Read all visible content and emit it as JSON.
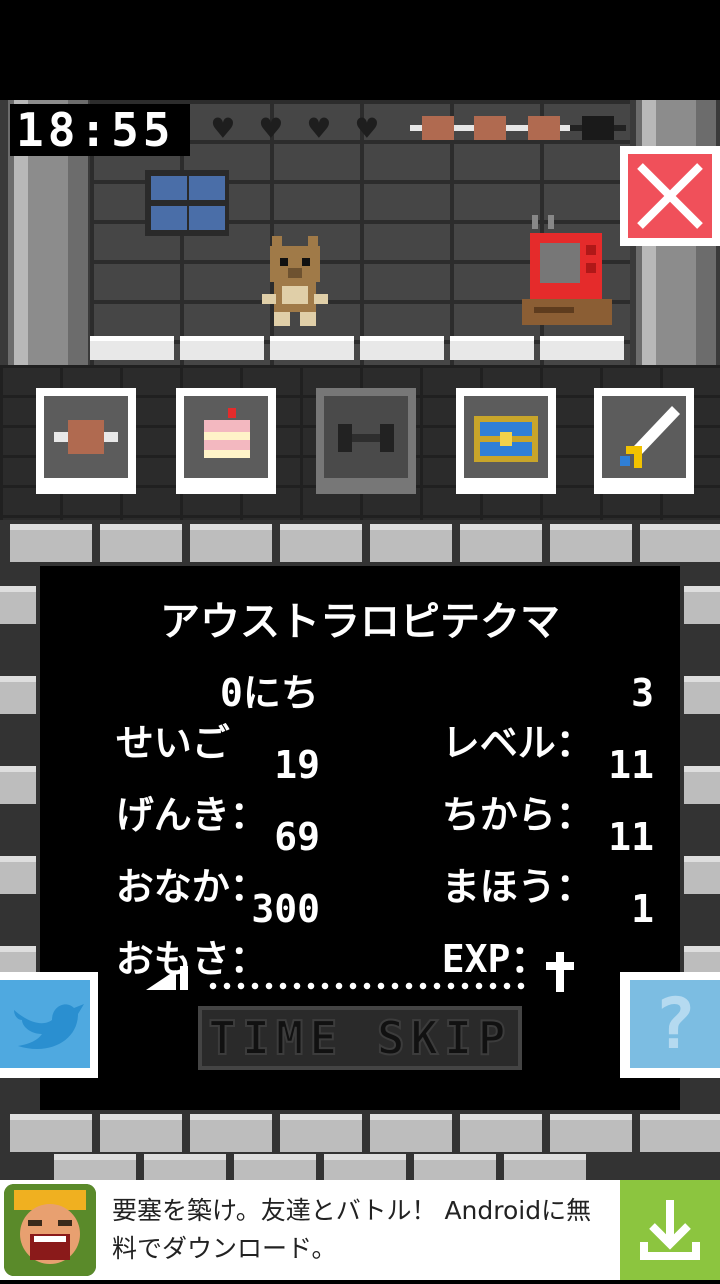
{
  "hud": {
    "clock": "18:55",
    "hearts_filled": 0,
    "hearts_total": 4,
    "food_filled": 3,
    "food_total": 4
  },
  "close_icon": "close-x-icon",
  "items": [
    {
      "name": "meat",
      "icon": "meat-icon",
      "enabled": true
    },
    {
      "name": "cake",
      "icon": "cake-icon",
      "enabled": true
    },
    {
      "name": "dumbbell",
      "icon": "dumbbell-icon",
      "enabled": false
    },
    {
      "name": "treasure",
      "icon": "treasure-chest-icon",
      "enabled": true
    },
    {
      "name": "sword",
      "icon": "sword-icon",
      "enabled": true
    }
  ],
  "stats": {
    "creature_name": "アウストラロピテクマ",
    "left": [
      {
        "label": "せいご",
        "value": "0にち"
      },
      {
        "label": "げんき：",
        "value": "19"
      },
      {
        "label": "おなか：",
        "value": "69"
      },
      {
        "label": "おもさ：",
        "value": "300"
      }
    ],
    "right": [
      {
        "label": "レベル：",
        "value": "3"
      },
      {
        "label": "ちから：",
        "value": "11"
      },
      {
        "label": "まほう：",
        "value": "11"
      },
      {
        "label": "EXP：",
        "value": "1"
      }
    ]
  },
  "time_skip_label": "TIME SKIP",
  "side_buttons": {
    "left_icon": "twitter-bird-icon",
    "right_icon": "question-mark-icon",
    "help_glyph": "?"
  },
  "ad": {
    "text": "要塞を築け。友達とバトル！ Androidに無料でダウンロード。",
    "download_icon": "download-arrow-icon"
  },
  "colors": {
    "close_button": "#f0505a",
    "ad_download": "#8cc53f",
    "twitter": "#4fa9e0"
  }
}
